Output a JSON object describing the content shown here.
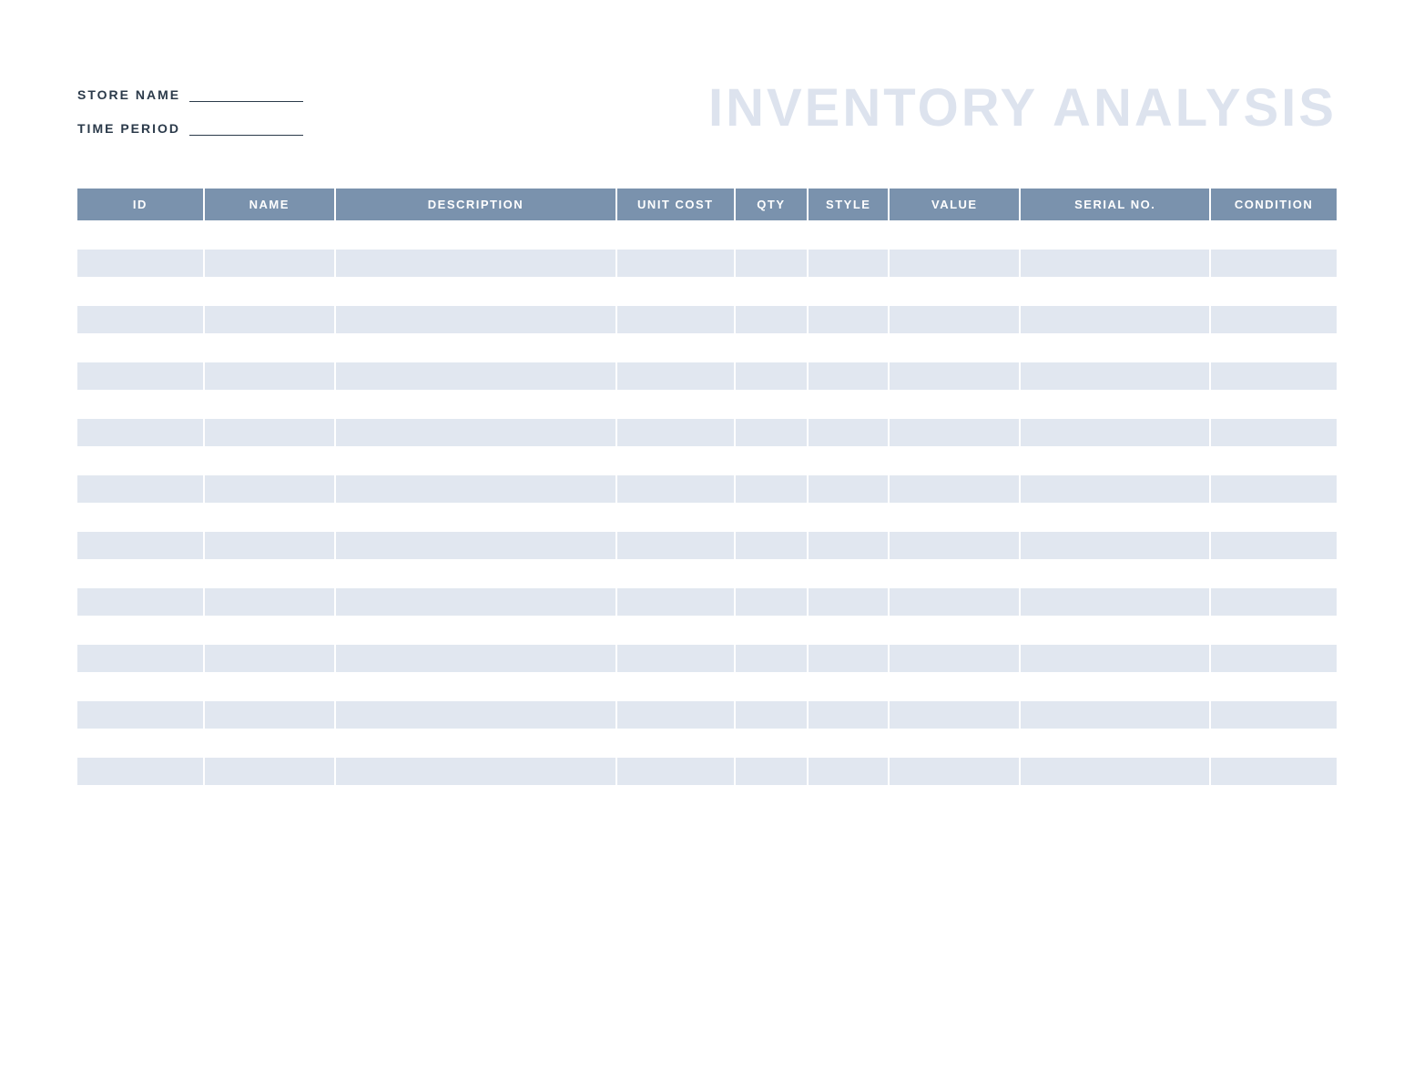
{
  "header": {
    "title": "INVENTORY ANALYSIS",
    "fields": {
      "store_name_label": "STORE NAME",
      "store_name_value": "",
      "time_period_label": "TIME PERIOD",
      "time_period_value": ""
    }
  },
  "table": {
    "columns": [
      {
        "key": "id",
        "label": "ID",
        "class": "col-id"
      },
      {
        "key": "name",
        "label": "NAME",
        "class": "col-name"
      },
      {
        "key": "description",
        "label": "DESCRIPTION",
        "class": "col-desc"
      },
      {
        "key": "unit_cost",
        "label": "UNIT COST",
        "class": "col-unitcost"
      },
      {
        "key": "qty",
        "label": "QTY",
        "class": "col-qty"
      },
      {
        "key": "style",
        "label": "STYLE",
        "class": "col-style"
      },
      {
        "key": "value",
        "label": "VALUE",
        "class": "col-value"
      },
      {
        "key": "serial_no",
        "label": "SERIAL NO.",
        "class": "col-serial"
      },
      {
        "key": "condition",
        "label": "CONDITION",
        "class": "col-condition"
      }
    ],
    "rows": [
      {
        "id": "",
        "name": "",
        "description": "",
        "unit_cost": "",
        "qty": "",
        "style": "",
        "value": "",
        "serial_no": "",
        "condition": ""
      },
      {
        "id": "",
        "name": "",
        "description": "",
        "unit_cost": "",
        "qty": "",
        "style": "",
        "value": "",
        "serial_no": "",
        "condition": ""
      },
      {
        "id": "",
        "name": "",
        "description": "",
        "unit_cost": "",
        "qty": "",
        "style": "",
        "value": "",
        "serial_no": "",
        "condition": ""
      },
      {
        "id": "",
        "name": "",
        "description": "",
        "unit_cost": "",
        "qty": "",
        "style": "",
        "value": "",
        "serial_no": "",
        "condition": ""
      },
      {
        "id": "",
        "name": "",
        "description": "",
        "unit_cost": "",
        "qty": "",
        "style": "",
        "value": "",
        "serial_no": "",
        "condition": ""
      },
      {
        "id": "",
        "name": "",
        "description": "",
        "unit_cost": "",
        "qty": "",
        "style": "",
        "value": "",
        "serial_no": "",
        "condition": ""
      },
      {
        "id": "",
        "name": "",
        "description": "",
        "unit_cost": "",
        "qty": "",
        "style": "",
        "value": "",
        "serial_no": "",
        "condition": ""
      },
      {
        "id": "",
        "name": "",
        "description": "",
        "unit_cost": "",
        "qty": "",
        "style": "",
        "value": "",
        "serial_no": "",
        "condition": ""
      },
      {
        "id": "",
        "name": "",
        "description": "",
        "unit_cost": "",
        "qty": "",
        "style": "",
        "value": "",
        "serial_no": "",
        "condition": ""
      },
      {
        "id": "",
        "name": "",
        "description": "",
        "unit_cost": "",
        "qty": "",
        "style": "",
        "value": "",
        "serial_no": "",
        "condition": ""
      },
      {
        "id": "",
        "name": "",
        "description": "",
        "unit_cost": "",
        "qty": "",
        "style": "",
        "value": "",
        "serial_no": "",
        "condition": ""
      },
      {
        "id": "",
        "name": "",
        "description": "",
        "unit_cost": "",
        "qty": "",
        "style": "",
        "value": "",
        "serial_no": "",
        "condition": ""
      },
      {
        "id": "",
        "name": "",
        "description": "",
        "unit_cost": "",
        "qty": "",
        "style": "",
        "value": "",
        "serial_no": "",
        "condition": ""
      },
      {
        "id": "",
        "name": "",
        "description": "",
        "unit_cost": "",
        "qty": "",
        "style": "",
        "value": "",
        "serial_no": "",
        "condition": ""
      },
      {
        "id": "",
        "name": "",
        "description": "",
        "unit_cost": "",
        "qty": "",
        "style": "",
        "value": "",
        "serial_no": "",
        "condition": ""
      },
      {
        "id": "",
        "name": "",
        "description": "",
        "unit_cost": "",
        "qty": "",
        "style": "",
        "value": "",
        "serial_no": "",
        "condition": ""
      },
      {
        "id": "",
        "name": "",
        "description": "",
        "unit_cost": "",
        "qty": "",
        "style": "",
        "value": "",
        "serial_no": "",
        "condition": ""
      },
      {
        "id": "",
        "name": "",
        "description": "",
        "unit_cost": "",
        "qty": "",
        "style": "",
        "value": "",
        "serial_no": "",
        "condition": ""
      },
      {
        "id": "",
        "name": "",
        "description": "",
        "unit_cost": "",
        "qty": "",
        "style": "",
        "value": "",
        "serial_no": "",
        "condition": ""
      },
      {
        "id": "",
        "name": "",
        "description": "",
        "unit_cost": "",
        "qty": "",
        "style": "",
        "value": "",
        "serial_no": "",
        "condition": ""
      },
      {
        "id": "",
        "name": "",
        "description": "",
        "unit_cost": "",
        "qty": "",
        "style": "",
        "value": "",
        "serial_no": "",
        "condition": ""
      }
    ]
  }
}
